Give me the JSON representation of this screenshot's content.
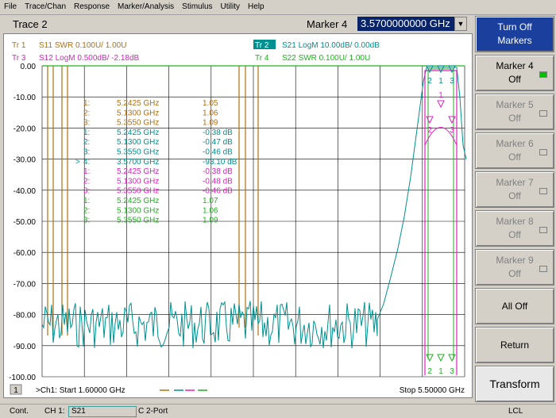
{
  "menu": [
    "File",
    "Trace/Chan",
    "Response",
    "Marker/Analysis",
    "Stimulus",
    "Utility",
    "Help"
  ],
  "title": {
    "trace": "Trace 2",
    "marker_label": "Marker 4",
    "marker_value": "3.5700000000 GHz"
  },
  "traces": [
    {
      "id": "Tr 1",
      "label": "S11 SWR 0.100U/  1.00U",
      "color": "#b07010"
    },
    {
      "id": "Tr 2",
      "label": "S21 LogM 10.00dB/  0.00dB",
      "color": "#009090"
    },
    {
      "id": "Tr 3",
      "label": "S12 LogM 0.500dB/  -2.18dB",
      "color": "#e020c0"
    },
    {
      "id": "Tr 4",
      "label": "S22 SWR 0.100U/  1.00U",
      "color": "#20b020"
    }
  ],
  "y_axis": [
    "0.00",
    "-10.00",
    "-20.00",
    "-30.00",
    "-40.00",
    "-50.00",
    "-60.00",
    "-70.00",
    "-80.00",
    "-90.00",
    "-100.00"
  ],
  "markers_table": [
    {
      "pre": "",
      "num": "1:",
      "freq": "5.2425 GHz",
      "val": "1.05",
      "color": "#b07010"
    },
    {
      "pre": "",
      "num": "2:",
      "freq": "5.1300 GHz",
      "val": "1.06",
      "color": "#b07010"
    },
    {
      "pre": "",
      "num": "3:",
      "freq": "5.3550 GHz",
      "val": "1.09",
      "color": "#b07010"
    },
    {
      "pre": "",
      "num": "1:",
      "freq": "5.2425 GHz",
      "val": "-0.38 dB",
      "color": "#009090"
    },
    {
      "pre": "",
      "num": "2:",
      "freq": "5.1300 GHz",
      "val": "-0.47 dB",
      "color": "#009090"
    },
    {
      "pre": "",
      "num": "3:",
      "freq": "5.3550 GHz",
      "val": "-0.46 dB",
      "color": "#009090"
    },
    {
      "pre": ">",
      "num": "4:",
      "freq": "3.5700 GHz",
      "val": "-93.10 dB",
      "color": "#009090"
    },
    {
      "pre": "",
      "num": "1:",
      "freq": "5.2425 GHz",
      "val": "-0.38 dB",
      "color": "#e020c0"
    },
    {
      "pre": "",
      "num": "2:",
      "freq": "5.1300 GHz",
      "val": "-0.48 dB",
      "color": "#e020c0"
    },
    {
      "pre": "",
      "num": "3:",
      "freq": "5.3550 GHz",
      "val": "-0.46 dB",
      "color": "#e020c0"
    },
    {
      "pre": "",
      "num": "1:",
      "freq": "5.2425 GHz",
      "val": "1.07",
      "color": "#20b020"
    },
    {
      "pre": "",
      "num": "2:",
      "freq": "5.1300 GHz",
      "val": "1.06",
      "color": "#20b020"
    },
    {
      "pre": "",
      "num": "3:",
      "freq": "5.3550 GHz",
      "val": "1.09",
      "color": "#20b020"
    }
  ],
  "plot_markers": {
    "top": [
      "2",
      "1",
      "3"
    ],
    "mid": [
      "1",
      "2",
      "3"
    ],
    "bottom": [
      "2",
      "1",
      "3"
    ]
  },
  "footer": {
    "channel_num": "1",
    "start": ">Ch1: Start  1.60000 GHz",
    "stop": "Stop  5.50000 GHz"
  },
  "status": {
    "cont": "Cont.",
    "ch": "CH 1:",
    "param": "S21",
    "cal": "C  2-Port",
    "lcl": "LCL"
  },
  "softkeys": [
    {
      "line1": "Turn Off",
      "line2": "Markers",
      "state": "active"
    },
    {
      "line1": "Marker 4",
      "line2": "Off",
      "state": "normal",
      "indicator": "on"
    },
    {
      "line1": "Marker 5",
      "line2": "Off",
      "state": "disabled",
      "indicator": "off"
    },
    {
      "line1": "Marker 6",
      "line2": "Off",
      "state": "disabled",
      "indicator": "off"
    },
    {
      "line1": "Marker 7",
      "line2": "Off",
      "state": "disabled",
      "indicator": "off"
    },
    {
      "line1": "Marker 8",
      "line2": "Off",
      "state": "disabled",
      "indicator": "off"
    },
    {
      "line1": "Marker 9",
      "line2": "Off",
      "state": "disabled",
      "indicator": "off"
    },
    {
      "line1": "All Off",
      "line2": "",
      "state": "normal"
    },
    {
      "line1": "Return",
      "line2": "",
      "state": "normal"
    },
    {
      "line1": "Transform",
      "line2": "",
      "state": "transform"
    }
  ],
  "colors": {
    "grid": "#000000",
    "s11": "#b07010",
    "s21": "#009090",
    "s12": "#e020c0",
    "s22": "#20b020",
    "active_key": "#1a3f9c"
  }
}
